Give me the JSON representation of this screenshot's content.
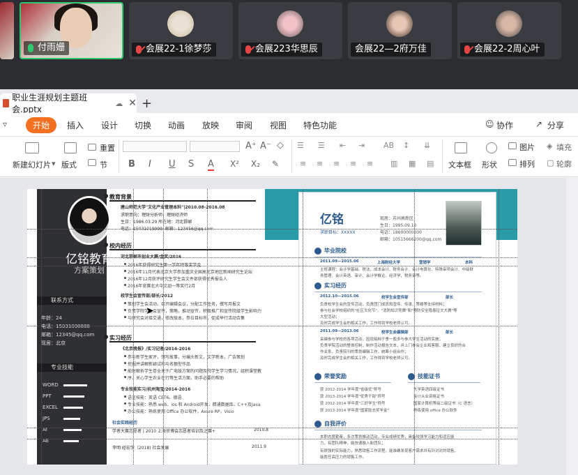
{
  "participants": [
    {
      "name": "付雨姗",
      "mic": "on",
      "active": true
    },
    {
      "name": "会展22-1徐梦莎",
      "mic": "muted"
    },
    {
      "name": "会展223华思辰",
      "mic": "muted"
    },
    {
      "name": "会展22—2府万佳",
      "mic": "none"
    },
    {
      "name": "会展22-2周心叶",
      "mic": "muted"
    }
  ],
  "document": {
    "tab_title": "职业生涯规划主题班会.pptx"
  },
  "menu": [
    "开始",
    "插入",
    "设计",
    "切换",
    "动画",
    "放映",
    "审阅",
    "视图",
    "特色功能"
  ],
  "menu_right": {
    "collab": "协作",
    "share": "分享"
  },
  "ribbon": {
    "new_slide": "新建幻灯片",
    "layout": "版式",
    "reset": "重置",
    "section": "节",
    "textbox": "文本框",
    "shape": "形状",
    "picture": "图片",
    "arrange": "排列",
    "fill": "填充",
    "outline": "轮廓"
  },
  "slide": {
    "resume1": {
      "name": "亿铭教育",
      "subtitle": "方案策划",
      "contact_head": "联系方式",
      "age": "年龄：24",
      "phone": "电话：15031000888",
      "email": "邮箱：12345@qq.com",
      "home": "现居：北京",
      "skills_head": "专业技能",
      "skills": [
        "WORD",
        "PPT",
        "EXCEL",
        "JPS",
        "AI",
        "AE"
      ],
      "edu_head": "教育背景",
      "edu_line": "唐山师范大学\"文化产业管理本科\"|2010.08-2016.08",
      "edu_detail1": "求职意向：理财分析师，理财经济师",
      "edu_detail2": "生日：1986.03.29      所在地：河北邯郸",
      "edu_detail3": "电话：15031019999.      邮箱：123456@qq.com",
      "campus_head": "校内经历",
      "campus_title": "河北邯郸市创业大赛/金奖/2016",
      "campus_items": [
        "2016年获得研究生第一学年特等奖学金",
        "2016年11月代表北京大学参加重庆全国高北京地区新闻研究生论坛",
        "2016年12月获评研究生学生会文件部获得优秀报告人",
        "2016年竞赛北大中文组一等奖行2月"
      ],
      "campus_title2": "校学生会宣传部/部长/2012",
      "campus_items2": [
        "策划学生会活动，召开编辑会议，分配工作任务，撰写月报文",
        "负责学院学生会宣传，策略，推动宣传，积极推广和宣传院级学生影响力",
        "与研究会对接交通，修改版本，参拉目标市，促成举行活动合集",
        ""
      ],
      "practice_head": "实习经历",
      "practice_title": "《北京晚报》/实习记者/2014-2016",
      "practice_items": [
        "参与新学生家评，领写故事，分编头新文，文学新本，广告策划",
        "挖掘并讲解新颖试和与名额型作品",
        "能时解析学生卷全关于广电版方案的问题及院学生学习情况，组积课堂教",
        "序，关心学生农业在行等生活方面，助手必要的帮助"
      ],
      "practice_title2": "专业技能实习/杭州淘宝/2014-2016",
      "practice_items2": [
        "语言技能：英语 CET6、德语",
        "专业技能：熟悉 web、ios 和 Android开发，精通数据库、C++及Java",
        "办公技能：熟练使用 Office 办公软件，Axure RP，Visio"
      ],
      "social_head": "社会实践经历",
      "social_line1": "学者大赛志愿者 | 2010 上海世博会志愿者培训及之赛+",
      "social_line2": "李明·经宏学（2018) 社会发展",
      "social_date1": "2010.8",
      "social_date2": "2011.9"
    },
    "resume2": {
      "name": "亿铭",
      "goal": "求职目标：XXXXX",
      "home": "现居：苏州高新区",
      "birthday": "生日：1995.09.10",
      "phone": "电话：18600000000",
      "email": "邮箱：10515666200@qq.com",
      "edu_head": "毕业院校",
      "edu_row": [
        "2011.09—2015.06",
        "上海财经大学",
        "营销学",
        "本科"
      ],
      "edu_desc1": "主修课程：会计学基础、税法、成本会计、财务会计、会计电算化、特殊审项会计、中级财",
      "edu_desc2": "务管理、会计英语、审计、会计学概论、经济学、税务审等。",
      "exp_head": "实习经历",
      "exp_row1": [
        "2012.10—2015.06",
        "校学生会宣传部",
        "部长"
      ],
      "exp_items1": [
        "负责校学生会的宣传活动，负责团门成员和宣传、传承、策略等支持材料；",
        "参与社会学校组织的\"社区文化节\"、\"消防知识竞赛\"和\"预防安全隐患征文大赛\"等",
        "大型活动；",
        "及时完成学生会的相关工作，工作得到学校老师认可。"
      ],
      "exp_row2": [
        "2011.09—2013.06",
        "校学生会编辑部",
        "部长"
      ],
      "exp_items2": [
        "采编参与学校的各项活动，因现拍档于季一般多与参大学生活动的实施；",
        "负责学院活动的整体控制，制作活动报告文本，并上门参会企业和客服，建立良好的合",
        "作关系，负责院刊的策划编辑工作，统筹小组合作；",
        "及时完成学生会的相关工作，工作得到学校老师认可。"
      ],
      "award_head": "荣誉奖励",
      "award_items": [
        "获 2012-2014 学年度\"省级优\"称号",
        "获 2013-2014 学年度\"优秀干部\"称号",
        "获 2012-2014 学年度\"三好学生\"称号",
        "获 2013-2014 学年度\"国家励志奖学金\""
      ],
      "cert_head": "技能证书",
      "cert_items": [
        "大学英语四级证书",
        "会计从业资格证书",
        "国家计算机等级二级证书（C 语言）",
        "熟练使用 office 办公软件"
      ],
      "self_head": "自我评价",
      "self_items": [
        "本职态度勤奋，多次策划推动活动，专业成绩优秀，具备较强学习能力和适应能",
        "力，有团队精神，能快速融入新团队；",
        "有很强的实际能力，熟悉销售工作流程，能准确发现客户需求并有针对对的销售，",
        "能胜任高压力的销售工作。"
      ]
    }
  }
}
